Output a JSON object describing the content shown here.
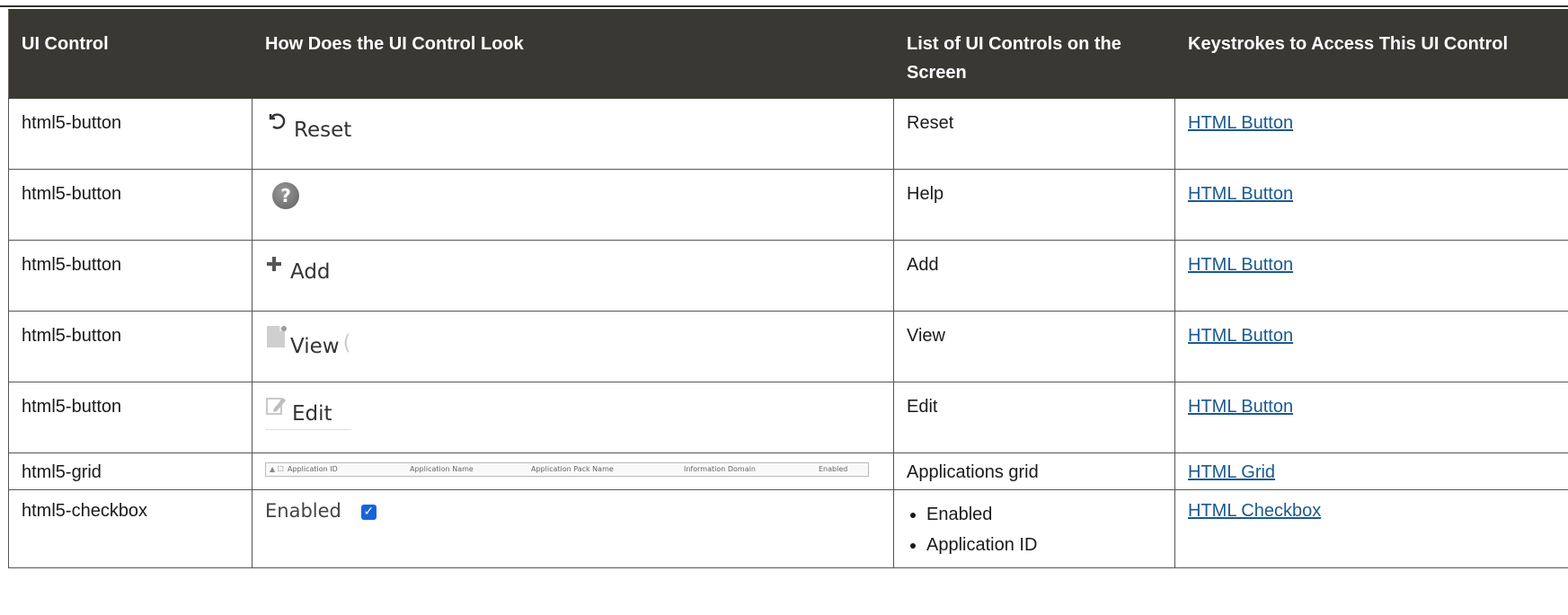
{
  "headers": [
    "UI Control",
    "How Does the UI Control Look",
    "List of UI Controls on the Screen",
    "Keystrokes to Access This UI Control"
  ],
  "rows": [
    {
      "control": "html5-button",
      "look": "Reset",
      "look_icon": "reset-icon",
      "list": "Reset",
      "link": "HTML Button"
    },
    {
      "control": "html5-button",
      "look": "",
      "look_icon": "help-icon",
      "list": "Help",
      "link": "HTML Button"
    },
    {
      "control": "html5-button",
      "look": "Add",
      "look_icon": "plus-icon",
      "list": "Add",
      "link": "HTML Button"
    },
    {
      "control": "html5-button",
      "look": "View",
      "look_icon": "view-icon",
      "list": "View",
      "link": "HTML Button"
    },
    {
      "control": "html5-button",
      "look": "Edit",
      "look_icon": "edit-icon",
      "list": "Edit",
      "link": "HTML Button"
    },
    {
      "control": "html5-grid",
      "grid_columns": [
        "Application ID",
        "Application Name",
        "Application Pack Name",
        "Information Domain",
        "Enabled"
      ],
      "list": "Applications grid",
      "link": "HTML Grid"
    },
    {
      "control": "html5-checkbox",
      "look": "Enabled",
      "look_icon": "checkbox-checked-icon",
      "list_items": [
        "Enabled",
        "Application ID"
      ],
      "link": "HTML Checkbox"
    }
  ],
  "colors": {
    "header_bg": "#3a3833",
    "link": "#1a5a8f",
    "checkbox": "#1565d8"
  }
}
